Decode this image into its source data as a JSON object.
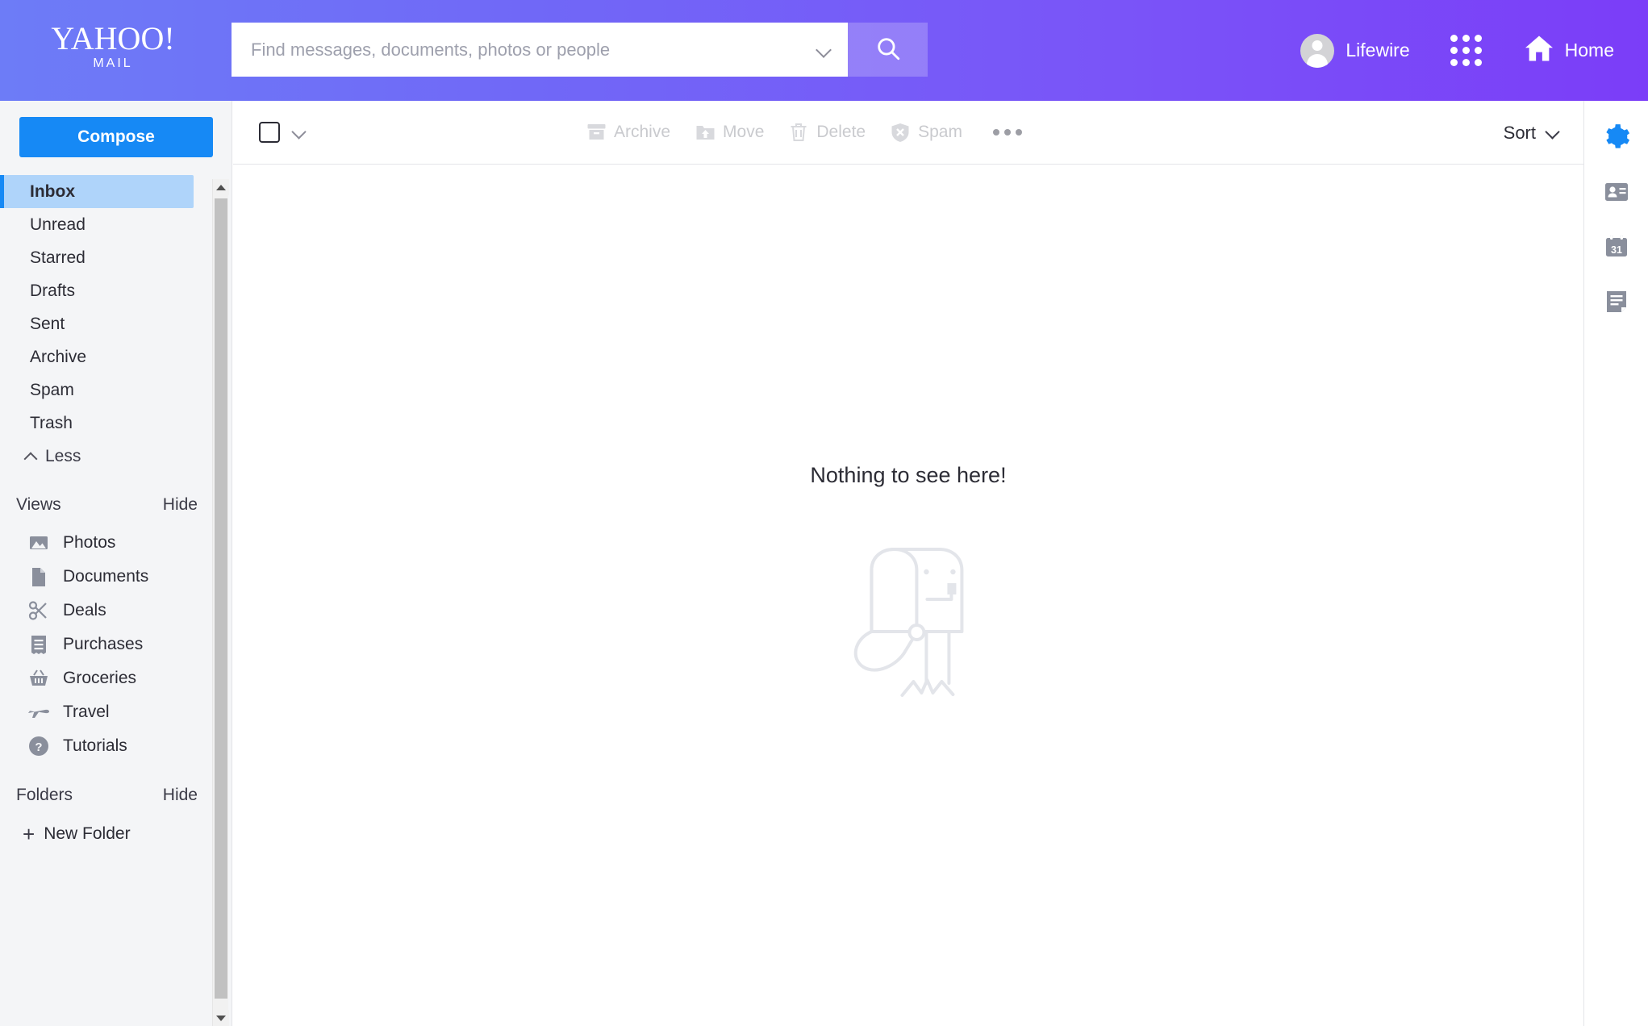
{
  "header": {
    "logo_main": "YAHOO!",
    "logo_sub": "MAIL",
    "search_placeholder": "Find messages, documents, photos or people",
    "search_value": "",
    "account_name": "Lifewire",
    "home_label": "Home",
    "gradient_left": "#6d7cf7",
    "gradient_right": "#7b3df8"
  },
  "sidebar": {
    "compose_label": "Compose",
    "folders": [
      {
        "label": "Inbox",
        "active": true
      },
      {
        "label": "Unread",
        "active": false
      },
      {
        "label": "Starred",
        "active": false
      },
      {
        "label": "Drafts",
        "active": false
      },
      {
        "label": "Sent",
        "active": false
      },
      {
        "label": "Archive",
        "active": false
      },
      {
        "label": "Spam",
        "active": false
      },
      {
        "label": "Trash",
        "active": false
      }
    ],
    "less_label": "Less",
    "views_title": "Views",
    "views_hide": "Hide",
    "views": [
      {
        "label": "Photos",
        "icon": "photos-icon"
      },
      {
        "label": "Documents",
        "icon": "document-icon"
      },
      {
        "label": "Deals",
        "icon": "scissors-icon"
      },
      {
        "label": "Purchases",
        "icon": "receipt-icon"
      },
      {
        "label": "Groceries",
        "icon": "basket-icon"
      },
      {
        "label": "Travel",
        "icon": "airplane-icon"
      },
      {
        "label": "Tutorials",
        "icon": "question-circle-icon"
      }
    ],
    "folders_title": "Folders",
    "folders_hide": "Hide",
    "new_folder_label": "New Folder",
    "compose_color": "#1689f5",
    "active_highlight": "#afd4fa"
  },
  "toolbar": {
    "archive_label": "Archive",
    "move_label": "Move",
    "delete_label": "Delete",
    "spam_label": "Spam",
    "sort_label": "Sort",
    "disabled_color": "#c9cace"
  },
  "main": {
    "empty_title": "Nothing to see here!",
    "empty_illustration": "open-mailbox-illustration"
  },
  "rail": {
    "items": [
      {
        "icon": "gear-icon",
        "color": "#1689f5"
      },
      {
        "icon": "contacts-card-icon",
        "color": "#8a8f9c"
      },
      {
        "icon": "calendar-icon",
        "label": "31",
        "color": "#8a8f9c"
      },
      {
        "icon": "notepad-icon",
        "color": "#8a8f9c"
      }
    ]
  }
}
